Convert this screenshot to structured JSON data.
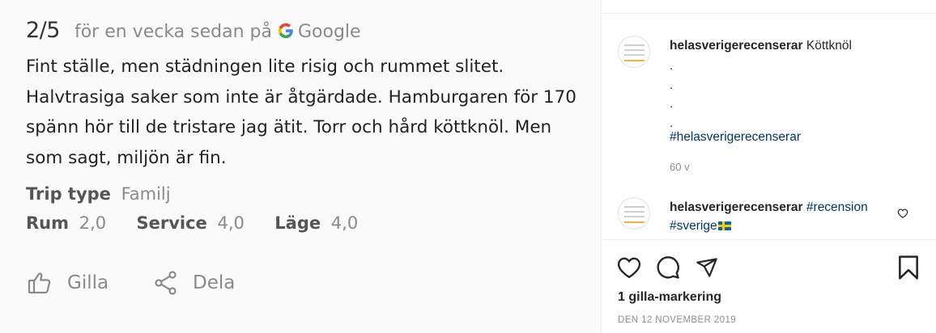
{
  "review": {
    "score": "2/5",
    "time_source": "för en vecka sedan på",
    "google_label": "Google",
    "text": "Fint ställe, men städningen lite risig och rummet slitet. Halvtrasiga saker som inte är åtgärdade. Hamburgaren för 170 spänn hör till de tristare jag ätit. Torr och hård köttknöl. Men som sagt, miljön är fin.",
    "trip_type_label": "Trip type",
    "trip_type_value": "Familj",
    "ratings": [
      {
        "label": "Rum",
        "value": "2,0"
      },
      {
        "label": "Service",
        "value": "4,0"
      },
      {
        "label": "Läge",
        "value": "4,0"
      }
    ],
    "like_label": "Gilla",
    "share_label": "Dela"
  },
  "post": {
    "caption": {
      "username": "helasverigerecenserar",
      "text": "Köttknöl",
      "dots": [
        ".",
        ".",
        ".",
        "."
      ],
      "hashtag": "#helasverigerecenserar",
      "time": "60 v"
    },
    "comment": {
      "username": "helasverigerecenserar",
      "hashtag1": "#recension",
      "hashtag2": "#sverige"
    },
    "likes": "1 gilla-markering",
    "date": "DEN 12 NOVEMBER 2019"
  },
  "colors": {
    "hashtag": "#00376b",
    "muted_text": "#8e8e8e",
    "flag_blue": "#006aa7",
    "flag_yellow": "#fecc00"
  }
}
